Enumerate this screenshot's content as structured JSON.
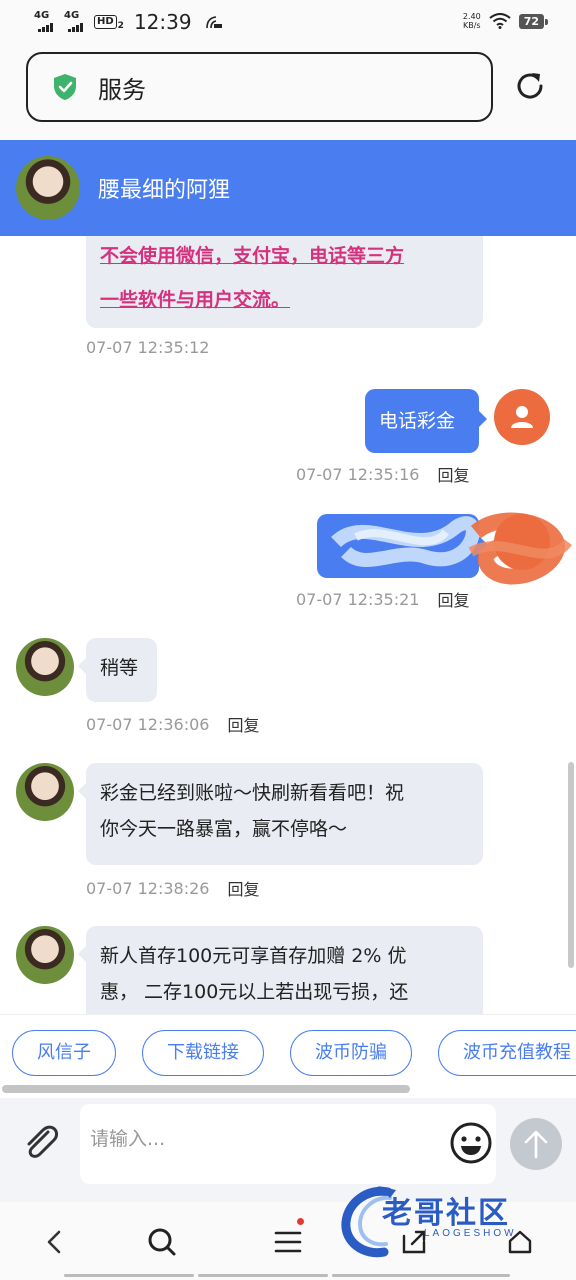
{
  "status_bar": {
    "sim1": "4G",
    "sim2": "4G",
    "hd_label": "HD",
    "hd_sub": "2",
    "time": "12:39",
    "net_speed": "2.40",
    "net_unit": "KB/s",
    "battery": "72"
  },
  "browser": {
    "url_title": "服务"
  },
  "chat_header": {
    "name": "腰最细的阿狸"
  },
  "messages": [
    {
      "side": "in",
      "lines": [
        "不会使用微信，支付宝，电话等三方",
        "一些软件与用户交流。"
      ],
      "time": "07-07 12:35:12"
    },
    {
      "side": "out",
      "text": "电话彩金",
      "time": "07-07 12:35:16",
      "reply": "回复"
    },
    {
      "side": "out",
      "text": "",
      "time": "07-07 12:35:21",
      "reply": "回复"
    },
    {
      "side": "in",
      "text": "稍等",
      "time": "07-07 12:36:06",
      "reply": "回复"
    },
    {
      "side": "in",
      "lines": [
        "彩金已经到账啦～快刷新看看吧！祝",
        "你今天一路暴富，赢不停咯～"
      ],
      "time": "07-07 12:38:26",
      "reply": "回复"
    },
    {
      "side": "in",
      "lines": [
        "新人首存100元可享首存加赠 2% 优",
        "惠， 二存100元以上若出现亏损，还"
      ]
    }
  ],
  "quick_replies": [
    "风信子",
    "下载链接",
    "波币防骗",
    "波币充值教程"
  ],
  "input": {
    "placeholder": "请输入..."
  },
  "watermark": {
    "text": "老哥社区",
    "sub": "LAOGESHOW"
  },
  "colors": {
    "accent": "#4a7ef0",
    "warning_text": "#d6317d",
    "user_avatar": "#ec6b3f"
  },
  "icons": [
    "shield-check-icon",
    "refresh-icon",
    "paperclip-icon",
    "emoji-icon",
    "send-arrow-icon",
    "back-icon",
    "search-icon",
    "menu-icon",
    "share-icon",
    "home-icon"
  ]
}
